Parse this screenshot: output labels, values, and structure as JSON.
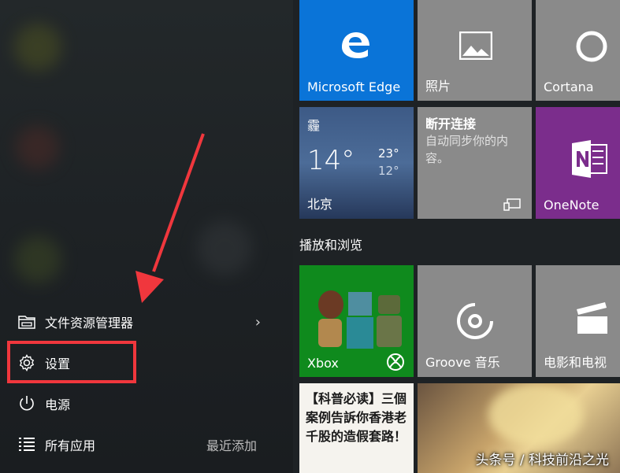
{
  "left_menu": {
    "file_explorer": "文件资源管理器",
    "settings": "设置",
    "power": "电源",
    "all_apps": "所有应用",
    "recently_added": "最近添加"
  },
  "tiles": {
    "edge": "Microsoft Edge",
    "photos": "照片",
    "cortana": "Cortana",
    "weather": {
      "condition": "霾",
      "temp": "14°",
      "high": "23°",
      "low": "12°",
      "city": "北京"
    },
    "sync": {
      "title": "断开连接",
      "message": "自动同步你的内容。"
    },
    "onenote": "OneNote",
    "xbox": "Xbox",
    "groove": "Groove 音乐",
    "movies": "电影和电视",
    "news": "【科普必读】三個案例告訴你香港老千股的造假套路！"
  },
  "section_title": "播放和浏览",
  "watermark": "头条号 / 科技前沿之光",
  "colors": {
    "edge_tile": "#0a74d8",
    "gray_tile": "#8a8a8a",
    "onenote_tile": "#7b2d8c",
    "xbox_tile": "#0f8a1d",
    "highlight": "#f0373d"
  }
}
